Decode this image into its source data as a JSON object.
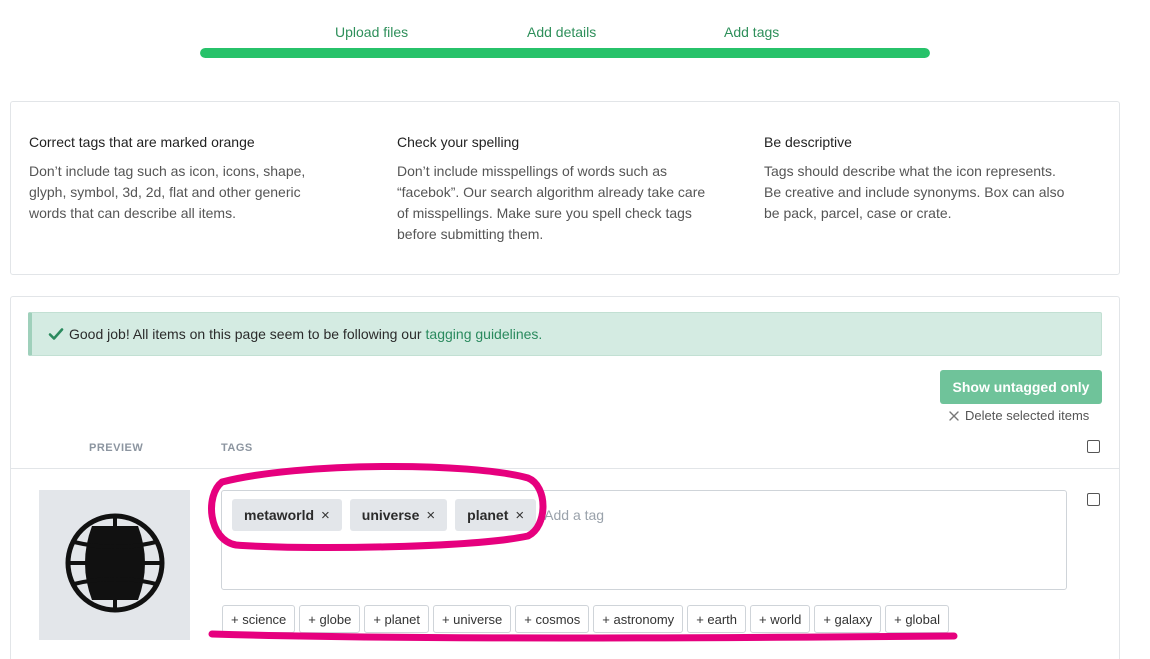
{
  "steps": {
    "items": [
      {
        "label": "Upload files"
      },
      {
        "label": "Add details"
      },
      {
        "label": "Add tags"
      }
    ],
    "progress_percent": 100
  },
  "guidelines": [
    {
      "title": "Correct tags that are marked orange",
      "body": "Don’t include tag such as icon, icons, shape, glyph, symbol, 3d, 2d, flat and other generic words that can describe all items."
    },
    {
      "title": "Check your spelling",
      "body": "Don’t include misspellings of words such as “facebok”. Our search algorithm already take care of misspellings. Make sure you spell check tags before submitting them."
    },
    {
      "title": "Be descriptive",
      "body": "Tags should describe what the icon represents. Be creative and include synonyms. Box can also be pack, parcel, case or crate."
    }
  ],
  "alert": {
    "text": "Good job! All items on this page seem to be following our",
    "link": "tagging guidelines."
  },
  "toolbar": {
    "show_untagged_label": "Show untagged only",
    "delete_selected_label": "Delete selected items"
  },
  "table": {
    "col_preview": "PREVIEW",
    "col_tags": "TAGS"
  },
  "item": {
    "icon": "globe-icon",
    "tags": [
      {
        "label": "metaworld"
      },
      {
        "label": "universe"
      },
      {
        "label": "planet"
      }
    ],
    "tag_placeholder": "Add a tag",
    "suggestions": [
      {
        "label": "+ science"
      },
      {
        "label": "+ globe"
      },
      {
        "label": "+ planet"
      },
      {
        "label": "+ universe"
      },
      {
        "label": "+ cosmos"
      },
      {
        "label": "+ astronomy"
      },
      {
        "label": "+ earth"
      },
      {
        "label": "+ world"
      },
      {
        "label": "+ galaxy"
      },
      {
        "label": "+ global"
      }
    ]
  },
  "colors": {
    "accent_green": "#27c26a",
    "link_green": "#2a8a5e",
    "button_green": "#6fc39a",
    "annotation_magenta": "#e6007e"
  }
}
